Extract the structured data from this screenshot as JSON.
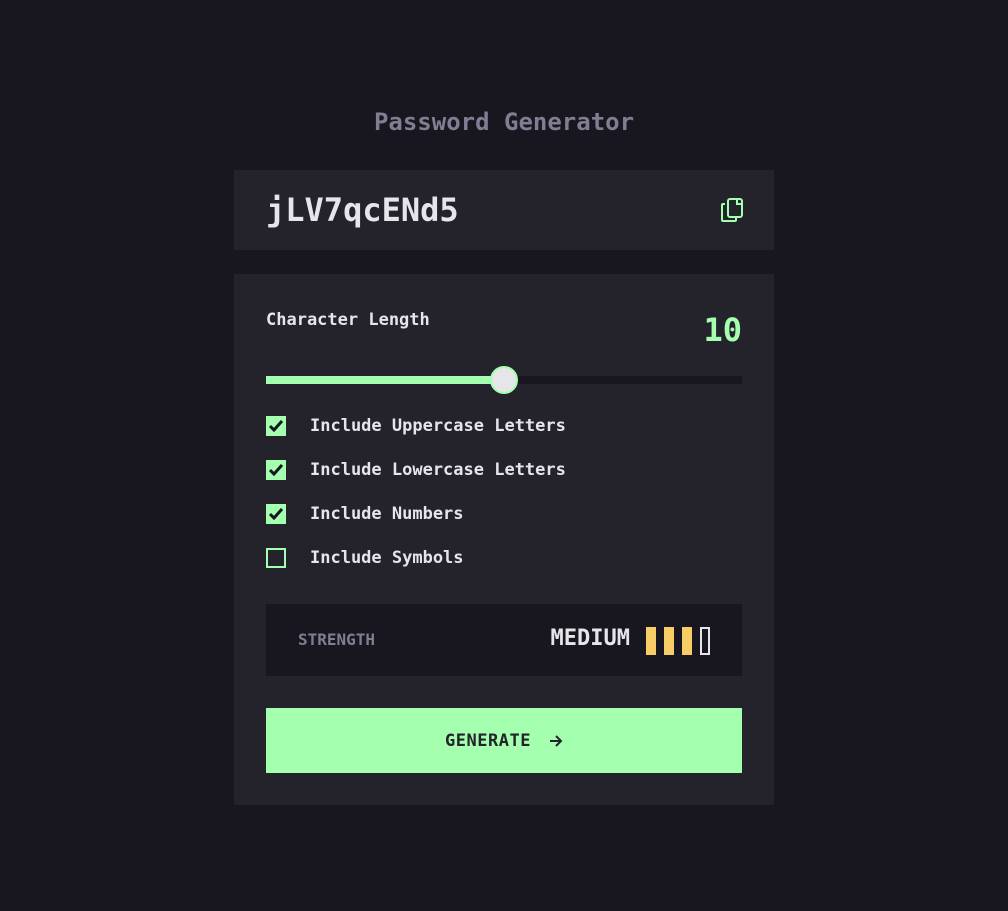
{
  "app": {
    "title": "Password Generator"
  },
  "password": {
    "value": "jLV7qcENd5",
    "copy_icon": "copy-icon"
  },
  "length": {
    "label": "Character Length",
    "value": "10",
    "slider_fraction": 0.5
  },
  "options": [
    {
      "label": "Include Uppercase Letters",
      "checked": true
    },
    {
      "label": "Include Lowercase Letters",
      "checked": true
    },
    {
      "label": "Include Numbers",
      "checked": true
    },
    {
      "label": "Include Symbols",
      "checked": false
    }
  ],
  "strength": {
    "label": "STRENGTH",
    "value": "MEDIUM",
    "level": 3,
    "max_level": 4
  },
  "generate": {
    "label": "GENERATE",
    "icon": "arrow-right-icon"
  },
  "colors": {
    "background": "#18171f",
    "panel": "#24232c",
    "accent": "#a4ffaf",
    "strength_medium": "#f8cd65",
    "text": "#e6e5ea",
    "muted": "#817d92"
  }
}
